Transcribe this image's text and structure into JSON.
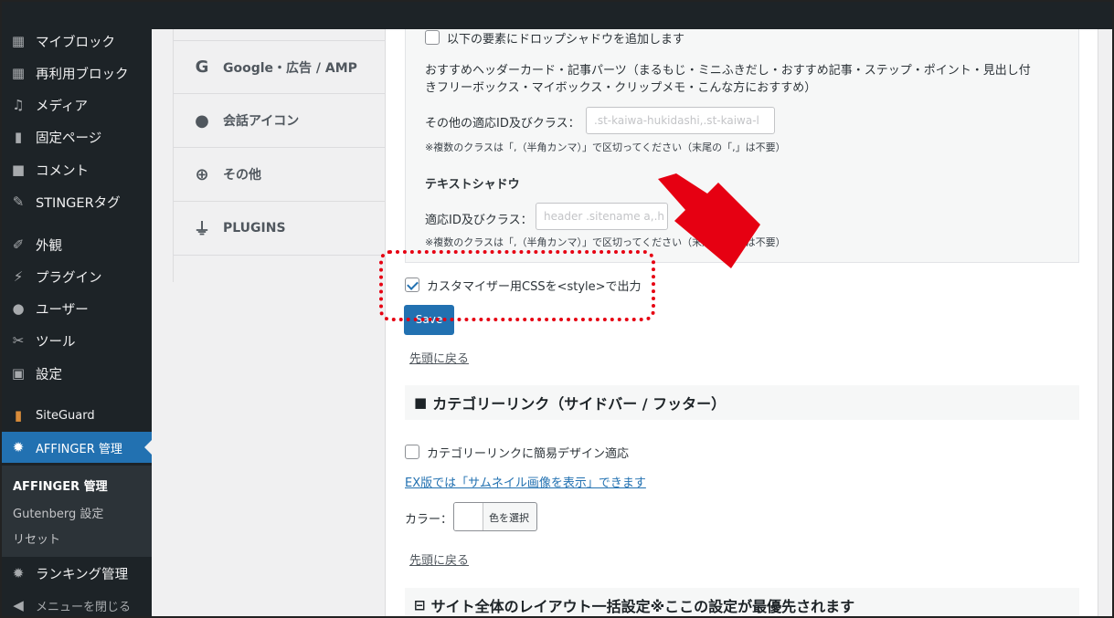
{
  "sidebar": {
    "items": [
      {
        "label": "マイブロック",
        "icon": "grid-icon"
      },
      {
        "label": "再利用ブロック",
        "icon": "grid-icon"
      },
      {
        "label": "メディア",
        "icon": "media-icon"
      },
      {
        "label": "固定ページ",
        "icon": "page-icon"
      },
      {
        "label": "コメント",
        "icon": "comment-icon"
      },
      {
        "label": "STINGERタグ",
        "icon": "pin-icon"
      },
      {
        "label": "外観",
        "icon": "brush-icon"
      },
      {
        "label": "プラグイン",
        "icon": "plugin-icon"
      },
      {
        "label": "ユーザー",
        "icon": "user-icon"
      },
      {
        "label": "ツール",
        "icon": "wrench-icon"
      },
      {
        "label": "設定",
        "icon": "settings-icon"
      },
      {
        "label": "SiteGuard",
        "icon": "siteguard-icon"
      },
      {
        "label": "AFFINGER 管理",
        "icon": "gear-icon"
      },
      {
        "label": "ランキング管理",
        "icon": "gear-icon"
      },
      {
        "label": "メニューを閉じる",
        "icon": "collapse-icon"
      }
    ],
    "submenu": [
      "AFFINGER 管理",
      "Gutenberg 設定",
      "リセット"
    ]
  },
  "tabs": [
    {
      "label": "Google・広告 / AMP",
      "icon": "google-icon"
    },
    {
      "label": "会話アイコン",
      "icon": "speech-bubble-icon"
    },
    {
      "label": "その他",
      "icon": "plus-circle-icon"
    },
    {
      "label": "PLUGINS",
      "icon": "plug-icon"
    }
  ],
  "main": {
    "drop_shadow_label": "以下の要素にドロップシャドウを追加します",
    "desc_line1": "おすすめヘッダーカード・記事パーツ（まるもじ・ミニふきだし・おすすめ記事・ステップ・ポイント・見出し付",
    "desc_line2": "きフリーボックス・マイボックス・クリップメモ・こんな方におすすめ）",
    "other_id_label": "その他の適応ID及びクラス：",
    "other_id_placeholder": ".st-kaiwa-hukidashi,.st-kaiwa-l",
    "note1": "※複数のクラスは「,（半角カンマ）」で区切ってください（末尾の「,」は不要）",
    "text_shadow_heading": "テキストシャドウ",
    "apply_id_label": "適応ID及びクラス：",
    "apply_id_placeholder": "header .sitename a,.h",
    "note2": "※複数のクラスは「,（半角カンマ）」で区切ってください（末尾の「,」は不要）",
    "customizer_css_label": "カスタマイザー用CSSを<style>で出力",
    "save_label": "Save",
    "back_to_top": "先頭に戻る",
    "category_heading": "カテゴリーリンク（サイドバー / フッター）",
    "category_checkbox_label": "カテゴリーリンクに簡易デザイン適応",
    "ex_link": "EX版では「サムネイル画像を表示」できます",
    "color_label": "カラー：",
    "color_button": "色を選択",
    "back_to_top2": "先頭に戻る",
    "layout_heading": "サイト全体のレイアウト一括設定※ここの設定が最優先されます"
  },
  "annotation_color": "#e60012"
}
